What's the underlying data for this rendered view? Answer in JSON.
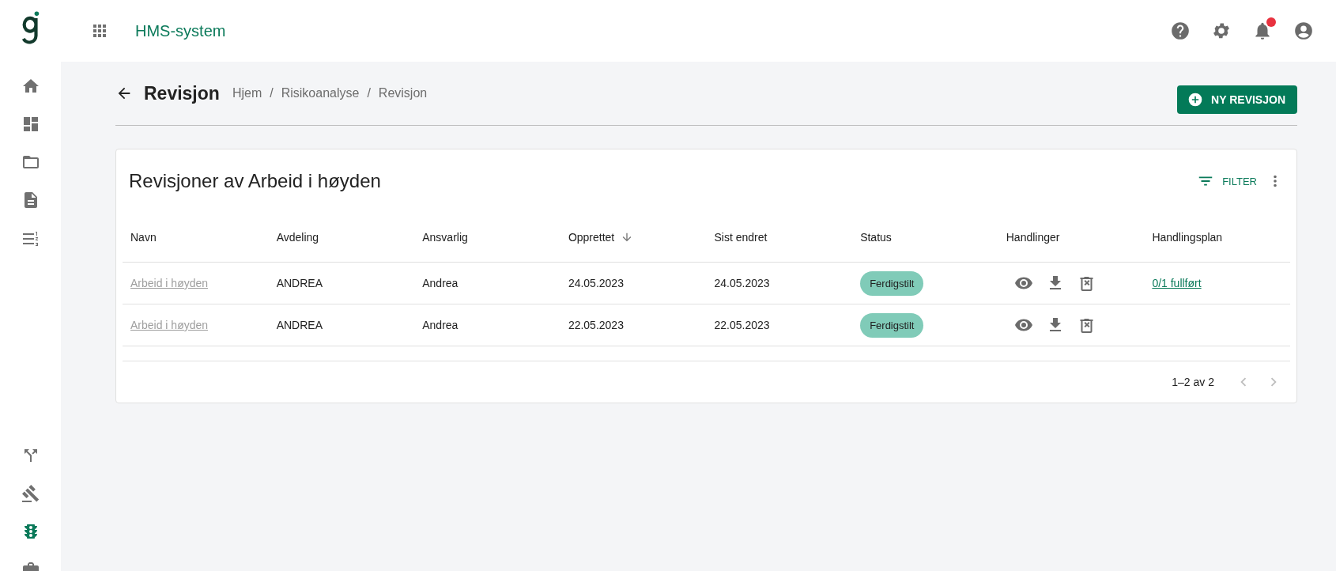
{
  "topbar": {
    "app_name": "HMS-system",
    "notifications_unread": true
  },
  "sidebar": {
    "items": [
      {
        "selected": false
      },
      {
        "selected": false
      },
      {
        "selected": false
      },
      {
        "selected": false
      },
      {
        "selected": false
      }
    ],
    "bottom_items": [
      {
        "selected": false
      },
      {
        "selected": false
      },
      {
        "selected": true
      },
      {
        "selected": false
      }
    ]
  },
  "page": {
    "title": "Revisjon",
    "breadcrumbs": [
      "Hjem",
      "Risikoanalyse",
      "Revisjon"
    ],
    "separator": "/",
    "primary_button": "NY REVISJON"
  },
  "card": {
    "title": "Revisjoner av Arbeid i høyden",
    "filter_button": "FILTER"
  },
  "table": {
    "columns": [
      {
        "label": "Navn",
        "sorted": false
      },
      {
        "label": "Avdeling",
        "sorted": false
      },
      {
        "label": "Ansvarlig",
        "sorted": false
      },
      {
        "label": "Opprettet",
        "sorted": true
      },
      {
        "label": "Sist endret",
        "sorted": false
      },
      {
        "label": "Status",
        "sorted": false
      },
      {
        "label": "Handlinger",
        "sorted": false
      },
      {
        "label": "Handlingsplan",
        "sorted": false
      }
    ],
    "rows": [
      {
        "name": "Arbeid i høyden",
        "department": "ANDREA",
        "responsible": "Andrea",
        "created": "24.05.2023",
        "modified": "24.05.2023",
        "status": "Ferdigstilt",
        "action_plan": "0/1 fullført"
      },
      {
        "name": "Arbeid i høyden",
        "department": "ANDREA",
        "responsible": "Andrea",
        "created": "22.05.2023",
        "modified": "22.05.2023",
        "status": "Ferdigstilt"
      }
    ]
  },
  "pagination": {
    "range": "1–2 av 2",
    "prev_disabled": true,
    "next_disabled": true
  }
}
